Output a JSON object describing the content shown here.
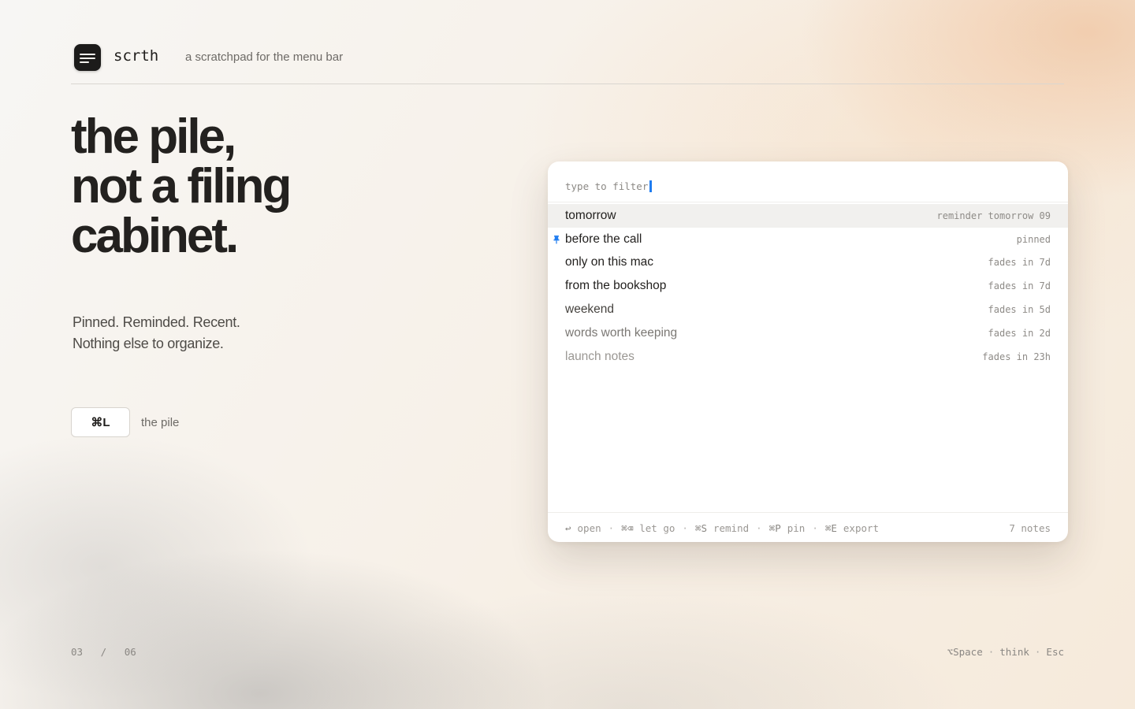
{
  "header": {
    "brand": "scrth",
    "tagline": "a scratchpad for the menu bar",
    "logo_icon": "note-lines-icon"
  },
  "hero": {
    "headline_lines": [
      "the pile,",
      "not a filing",
      "cabinet."
    ],
    "sub_lines": [
      "Pinned. Reminded. Recent.",
      "Nothing else to organize."
    ],
    "shortcut_key": "⌘L",
    "shortcut_label": "the pile"
  },
  "panel": {
    "filter_placeholder": "type to filter",
    "notes": [
      {
        "title": "tomorrow",
        "meta": "reminder tomorrow 09",
        "selected": true,
        "pinned": false
      },
      {
        "title": "before the call",
        "meta": "pinned",
        "selected": false,
        "pinned": true
      },
      {
        "title": "only on this mac",
        "meta": "fades in 7d",
        "selected": false,
        "pinned": false
      },
      {
        "title": "from the bookshop",
        "meta": "fades in 7d",
        "selected": false,
        "pinned": false
      },
      {
        "title": "weekend",
        "meta": "fades in 5d",
        "selected": false,
        "pinned": false
      },
      {
        "title": "words worth keeping",
        "meta": "fades in 2d",
        "selected": false,
        "pinned": false
      },
      {
        "title": "launch notes",
        "meta": "fades in 23h",
        "selected": false,
        "pinned": false
      }
    ],
    "footer": {
      "actions": [
        {
          "key": "↩",
          "label": "open"
        },
        {
          "key": "⌘⌫",
          "label": "let go"
        },
        {
          "key": "⌘S",
          "label": "remind"
        },
        {
          "key": "⌘P",
          "label": "pin"
        },
        {
          "key": "⌘E",
          "label": "export"
        }
      ],
      "separator": "·",
      "count": "7 notes"
    }
  },
  "bottom": {
    "page_current": "03",
    "page_separator": "/",
    "page_total": "06",
    "hints": [
      "⌥Space",
      "think",
      "Esc"
    ],
    "hint_separator": "·"
  },
  "colors": {
    "accent": "#1f7cf0",
    "logo_bg": "#1c1b1a",
    "selected_row": "#f1f0ee"
  }
}
